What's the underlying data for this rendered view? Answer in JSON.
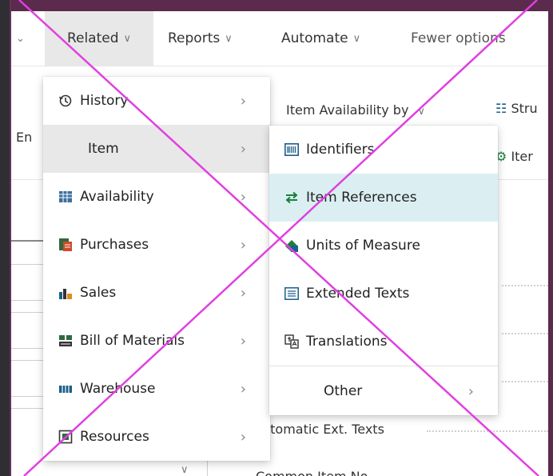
{
  "actionbar": {
    "items": [
      {
        "label": "Related"
      },
      {
        "label": "Reports"
      },
      {
        "label": "Automate"
      },
      {
        "label": "Fewer options"
      }
    ]
  },
  "background": {
    "item_availability": "Item Availability by",
    "struct_partial": "Stru",
    "item_partial": "Iter",
    "en_partial": "En",
    "auto_ext_texts": "utomatic Ext. Texts",
    "common_item_no": "Common Item No."
  },
  "related_menu": {
    "items": [
      {
        "label": "History",
        "icon": "history-icon"
      },
      {
        "label": "Item",
        "icon": ""
      },
      {
        "label": "Availability",
        "icon": "availability-icon"
      },
      {
        "label": "Purchases",
        "icon": "purchases-icon"
      },
      {
        "label": "Sales",
        "icon": "sales-icon"
      },
      {
        "label": "Bill of Materials",
        "icon": "bom-icon"
      },
      {
        "label": "Warehouse",
        "icon": "warehouse-icon"
      },
      {
        "label": "Resources",
        "icon": "resources-icon"
      }
    ]
  },
  "item_submenu": {
    "items": [
      {
        "label": "Identifiers",
        "icon": "barcode-icon"
      },
      {
        "label": "Item References",
        "icon": "swap-arrows-icon"
      },
      {
        "label": "Units of Measure",
        "icon": "units-icon"
      },
      {
        "label": "Extended Texts",
        "icon": "text-list-icon"
      },
      {
        "label": "Translations",
        "icon": "translate-icon"
      },
      {
        "label": "Other",
        "icon": ""
      }
    ]
  },
  "colors": {
    "frame": "#5b2a4d",
    "menu_active": "#e8e8e8",
    "menu_highlight": "#dbeff3",
    "accent_green": "#1b7f3b",
    "cross": "#e040e0"
  }
}
